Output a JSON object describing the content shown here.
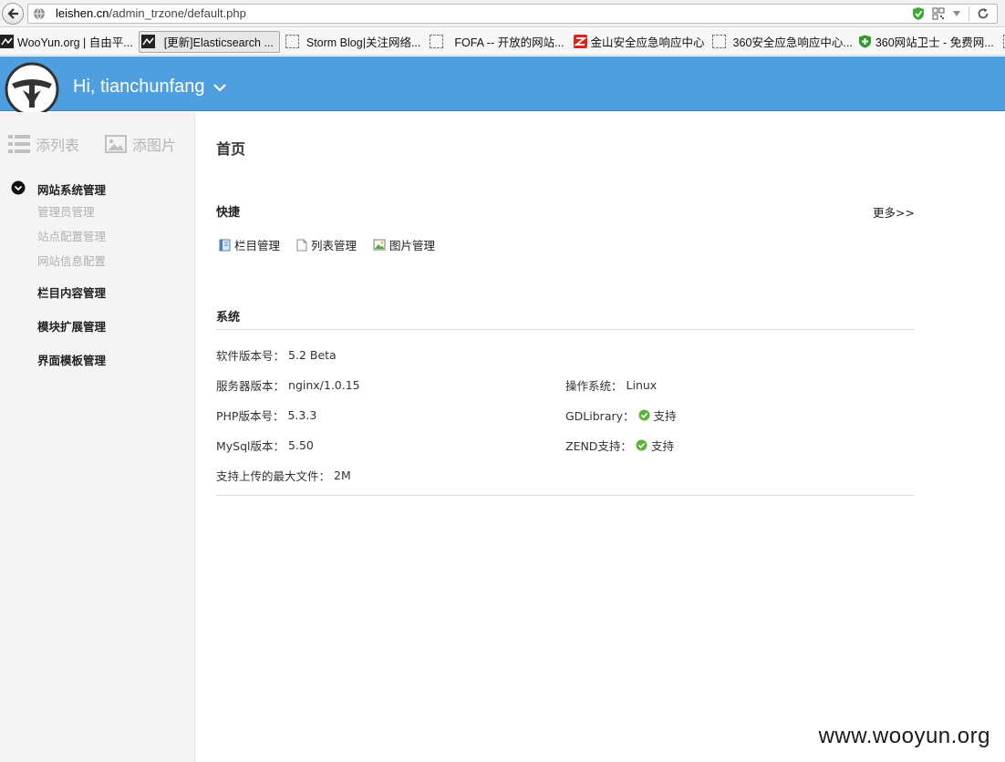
{
  "browser": {
    "url_domain": "leishen.cn",
    "url_path": "/admin_trzone/default.php",
    "bookmarks": [
      {
        "label": "WooYun.org | 自由平...",
        "active": false
      },
      {
        "label": "[更新]Elasticsearch ...",
        "active": true
      },
      {
        "label": "Storm Blog|关注网络...",
        "active": false
      },
      {
        "label": "FOFA -- 开放的网站...",
        "active": false
      },
      {
        "label": "金山安全应急响应中心",
        "active": false
      },
      {
        "label": "360安全应急响应中心...",
        "active": false
      },
      {
        "label": "360网站卫士 - 免费网...",
        "active": false
      }
    ]
  },
  "header": {
    "greeting": "Hi, tianchunfang",
    "accent": "#4f9ee0"
  },
  "sidebar": {
    "tools": [
      {
        "label": "添列表",
        "icon": "list-icon"
      },
      {
        "label": "添图片",
        "icon": "image-icon"
      }
    ],
    "groups": [
      {
        "title": "网站系统管理",
        "expanded": true,
        "items": [
          "管理员管理",
          "站点配置管理",
          "网站信息配置"
        ]
      },
      {
        "title": "栏目内容管理"
      },
      {
        "title": "模块扩展管理"
      },
      {
        "title": "界面模板管理"
      }
    ]
  },
  "main": {
    "page_title": "首页",
    "quick": {
      "title": "快捷",
      "more": "更多>>",
      "links": [
        {
          "label": "栏目管理",
          "icon": "book-icon"
        },
        {
          "label": "列表管理",
          "icon": "page-icon"
        },
        {
          "label": "图片管理",
          "icon": "picture-icon"
        }
      ]
    },
    "system": {
      "title": "系统",
      "software_label": "软件版本号：",
      "software_value": "5.2 Beta",
      "server_label": "服务器版本：",
      "server_value": "nginx/1.0.15",
      "os_label": "操作系统：",
      "os_value": "Linux",
      "php_label": "PHP版本号：",
      "php_value": "5.3.3",
      "gd_label": "GDLibrary：",
      "gd_value": "支持",
      "mysql_label": "MySql版本：",
      "mysql_value": "5.50",
      "zend_label": "ZEND支持：",
      "zend_value": "支持",
      "upload_label": "支持上传的最大文件：",
      "upload_value": "2M"
    }
  },
  "watermark": "www.wooyun.org"
}
